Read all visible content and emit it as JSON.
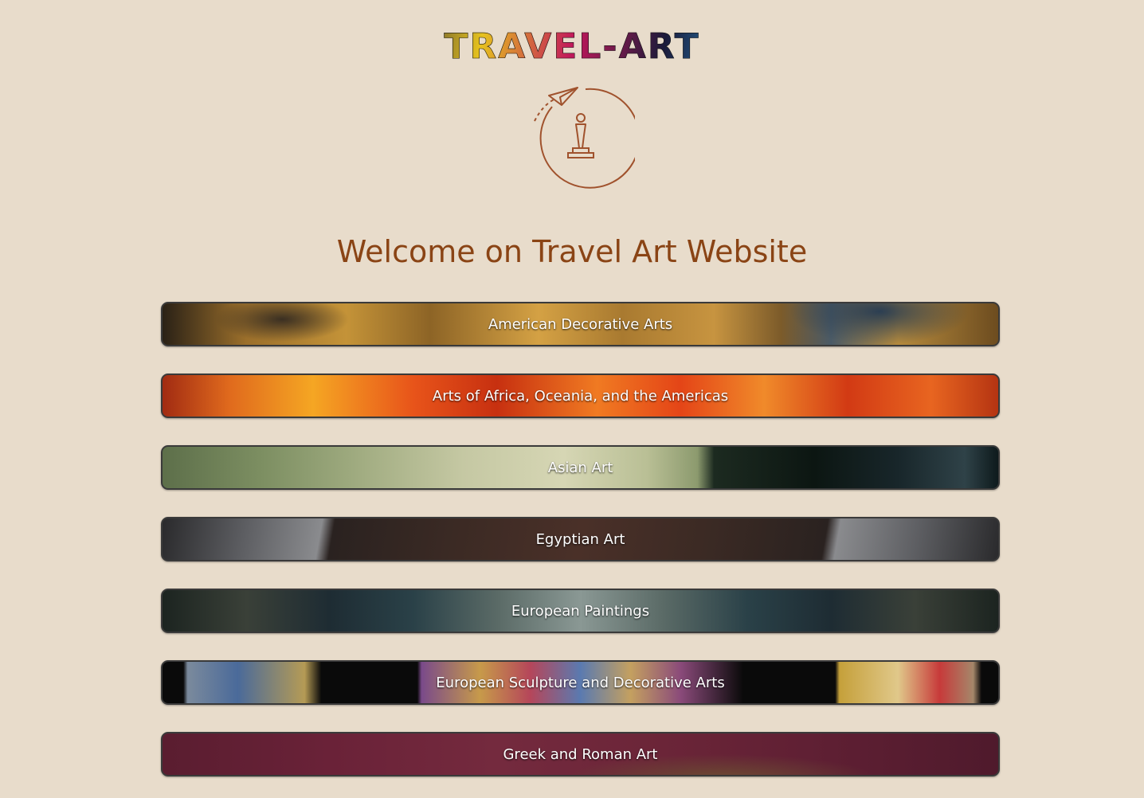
{
  "brand": {
    "title": "TRAVEL-ART"
  },
  "logo": {
    "icon": "paper-plane-trophy-icon",
    "color": "#a0522d"
  },
  "welcome": {
    "heading": "Welcome on Travel Art Website"
  },
  "colors": {
    "background": "#e8dccb",
    "heading": "#8a4415",
    "button_text": "#ffffff"
  },
  "departments": [
    {
      "label": "American Decorative Arts"
    },
    {
      "label": "Arts of Africa, Oceania, and the Americas"
    },
    {
      "label": "Asian Art"
    },
    {
      "label": "Egyptian Art"
    },
    {
      "label": "European Paintings"
    },
    {
      "label": "European Sculpture and Decorative Arts"
    },
    {
      "label": "Greek and Roman Art"
    }
  ]
}
